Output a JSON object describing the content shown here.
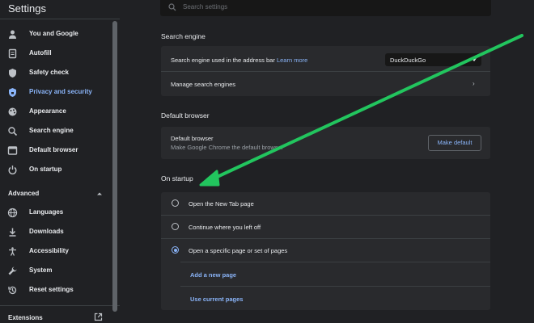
{
  "app": {
    "title": "Settings"
  },
  "search": {
    "placeholder": "Search settings",
    "icon": "search-icon"
  },
  "sidebar": {
    "items": [
      {
        "label": "You and Google",
        "icon": "person-icon",
        "active": false
      },
      {
        "label": "Autofill",
        "icon": "clipboard-icon",
        "active": false
      },
      {
        "label": "Safety check",
        "icon": "shield-icon",
        "active": false
      },
      {
        "label": "Privacy and security",
        "icon": "shield-lock-icon",
        "active": true
      },
      {
        "label": "Appearance",
        "icon": "palette-icon",
        "active": false
      },
      {
        "label": "Search engine",
        "icon": "search-icon",
        "active": false
      },
      {
        "label": "Default browser",
        "icon": "browser-icon",
        "active": false
      },
      {
        "label": "On startup",
        "icon": "power-icon",
        "active": false
      }
    ],
    "advanced_label": "Advanced",
    "advanced_items": [
      {
        "label": "Languages",
        "icon": "globe-icon"
      },
      {
        "label": "Downloads",
        "icon": "download-icon"
      },
      {
        "label": "Accessibility",
        "icon": "accessibility-icon"
      },
      {
        "label": "System",
        "icon": "wrench-icon"
      },
      {
        "label": "Reset settings",
        "icon": "history-icon"
      }
    ],
    "extensions_label": "Extensions"
  },
  "search_engine": {
    "title": "Search engine",
    "address_bar_label": "Search engine used in the address bar",
    "learn_more": "Learn more",
    "selected_engine": "DuckDuckGo",
    "manage_label": "Manage search engines"
  },
  "default_browser": {
    "title": "Default browser",
    "row_title": "Default browser",
    "row_subtitle": "Make Google Chrome the default browser",
    "button_label": "Make default"
  },
  "on_startup": {
    "title": "On startup",
    "options": [
      {
        "label": "Open the New Tab page",
        "selected": false
      },
      {
        "label": "Continue where you left off",
        "selected": false
      },
      {
        "label": "Open a specific page or set of pages",
        "selected": true
      }
    ],
    "add_page_label": "Add a new page",
    "use_current_label": "Use current pages"
  },
  "colors": {
    "background": "#202124",
    "card": "#292a2d",
    "accent": "#8ab4f8",
    "annotation_arrow": "#22c55e"
  }
}
